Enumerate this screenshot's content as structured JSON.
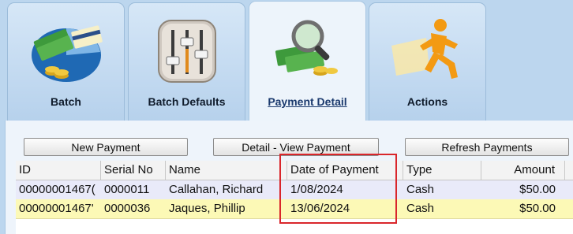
{
  "tabs": [
    {
      "label": "Batch",
      "icon": "money-card-chart-icon"
    },
    {
      "label": "Batch Defaults",
      "icon": "slider-settings-icon"
    },
    {
      "label": "Payment Detail",
      "icon": "money-magnifier-icon",
      "active": true
    },
    {
      "label": "Actions",
      "icon": "running-man-icon"
    }
  ],
  "buttons": {
    "new_payment": "New Payment",
    "detail_view": "Detail - View Payment",
    "refresh": "Refresh Payments"
  },
  "table": {
    "columns": [
      "ID",
      "Serial No",
      "Name",
      "Date of Payment",
      "Type",
      "Amount"
    ],
    "rows": [
      {
        "id": "00000001467(",
        "serial": "0000011",
        "name": "Callahan, Richard",
        "date": "1/08/2024",
        "type": "Cash",
        "amount": "$50.00"
      },
      {
        "id": "00000001467'",
        "serial": "0000036",
        "name": "Jaques, Phillip",
        "date": "13/06/2024",
        "type": "Cash",
        "amount": "$50.00"
      }
    ]
  },
  "colors": {
    "row_selected": "#e9eaf9",
    "row_highlight": "#fcf9b6",
    "annotation_box": "#d9262b"
  }
}
